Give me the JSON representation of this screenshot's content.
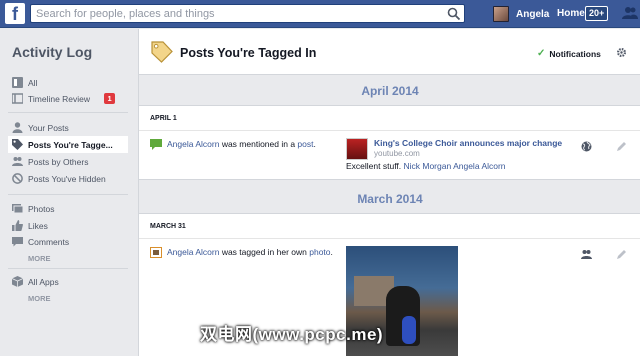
{
  "topbar": {
    "logo": "f",
    "search_placeholder": "Search for people, places and things",
    "user_name": "Angela",
    "home_label": "Home",
    "home_count": "20+"
  },
  "sidebar": {
    "title": "Activity Log",
    "items": [
      {
        "label": "All",
        "icon": "grid-icon"
      },
      {
        "label": "Timeline Review",
        "icon": "timeline-icon",
        "badge": "1"
      },
      {
        "label": "Your Posts",
        "icon": "person-icon"
      },
      {
        "label": "Posts You're Tagge...",
        "icon": "tag-icon",
        "active": true
      },
      {
        "label": "Posts by Others",
        "icon": "people-icon"
      },
      {
        "label": "Posts You've Hidden",
        "icon": "hidden-icon"
      },
      {
        "label": "Photos",
        "icon": "photos-icon"
      },
      {
        "label": "Likes",
        "icon": "like-icon"
      },
      {
        "label": "Comments",
        "icon": "comment-icon"
      },
      {
        "label": "All Apps",
        "icon": "apps-icon"
      }
    ],
    "more_label": "MORE"
  },
  "main": {
    "title": "Posts You're Tagged In",
    "notifications_label": "Notifications",
    "months": [
      {
        "label": "April 2014",
        "day": "APRIL 1",
        "story": {
          "actor": "Angela Alcorn",
          "text": " was mentioned in a ",
          "link": "post",
          "end": "."
        },
        "preview": {
          "title": "King's College Choir announces major change",
          "domain": "youtube.com",
          "caption_text": "Excellent stuff. ",
          "caption_links": "Nick Morgan Angela Alcorn"
        }
      },
      {
        "label": "March 2014",
        "day": "MARCH 31",
        "story": {
          "actor": "Angela Alcorn",
          "text": " was tagged in her own ",
          "link": "photo",
          "end": "."
        }
      }
    ]
  },
  "watermark": "双电网(www.pcpc.me)",
  "colors": {
    "brand": "#3b5998",
    "month": "#6d84b4",
    "badge": "#e0393e"
  }
}
